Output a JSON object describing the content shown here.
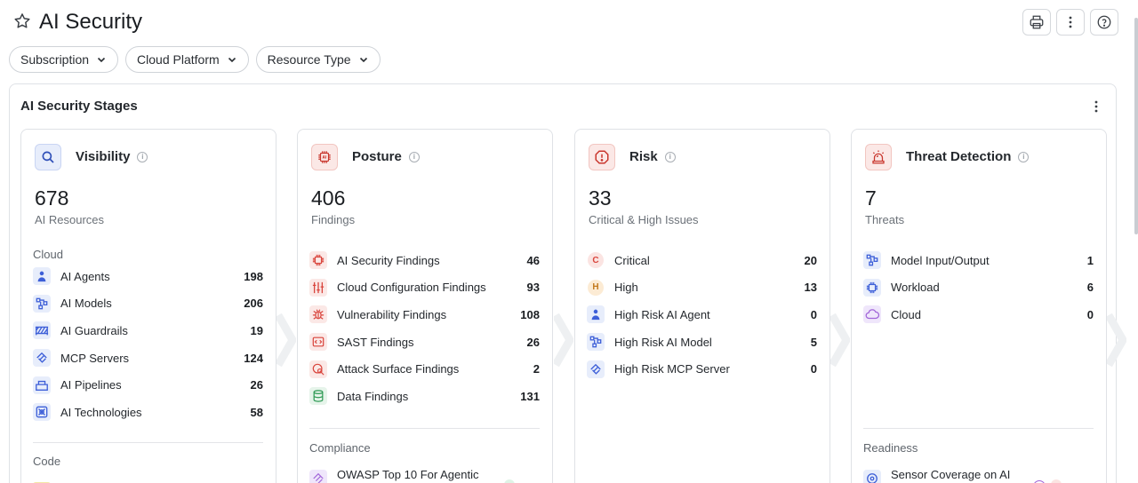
{
  "header": {
    "title": "AI Security"
  },
  "filters": [
    "Subscription",
    "Cloud Platform",
    "Resource Type"
  ],
  "panel": {
    "title": "AI Security Stages"
  },
  "cards": [
    {
      "title": "Visibility",
      "count": "678",
      "subtitle": "AI Resources",
      "sections": [
        {
          "label": "Cloud",
          "rows": [
            {
              "label": "AI Agents",
              "value": "198",
              "icon": "agent-icon"
            },
            {
              "label": "AI Models",
              "value": "206",
              "icon": "model-icon"
            },
            {
              "label": "AI Guardrails",
              "value": "19",
              "icon": "guardrail-icon"
            },
            {
              "label": "MCP Servers",
              "value": "124",
              "icon": "mcp-icon"
            },
            {
              "label": "AI Pipelines",
              "value": "26",
              "icon": "pipeline-icon"
            },
            {
              "label": "AI Technologies",
              "value": "58",
              "icon": "technology-icon"
            }
          ]
        },
        {
          "label": "Code",
          "rows": []
        }
      ]
    },
    {
      "title": "Posture",
      "count": "406",
      "subtitle": "Findings",
      "sections": [
        {
          "label": "",
          "rows": [
            {
              "label": "AI Security Findings",
              "value": "46",
              "icon": "ai-chip-icon"
            },
            {
              "label": "Cloud Configuration Findings",
              "value": "93",
              "icon": "sliders-icon"
            },
            {
              "label": "Vulnerability Findings",
              "value": "108",
              "icon": "bug-icon"
            },
            {
              "label": "SAST Findings",
              "value": "26",
              "icon": "code-icon"
            },
            {
              "label": "Attack Surface Findings",
              "value": "2",
              "icon": "attack-surface-icon"
            },
            {
              "label": "Data Findings",
              "value": "131",
              "icon": "database-icon"
            }
          ]
        },
        {
          "label": "Compliance",
          "rows": [
            {
              "label": "OWASP Top 10 For Agentic",
              "value": "",
              "icon": "owasp-icon"
            }
          ]
        }
      ]
    },
    {
      "title": "Risk",
      "count": "33",
      "subtitle": "Critical & High Issues",
      "sections": [
        {
          "label": "",
          "rows": [
            {
              "label": "Critical",
              "value": "20",
              "letter": "C",
              "icon": "critical-badge-icon"
            },
            {
              "label": "High",
              "value": "13",
              "letter": "H",
              "icon": "high-badge-icon"
            },
            {
              "label": "High Risk AI Agent",
              "value": "0",
              "icon": "agent-icon"
            },
            {
              "label": "High Risk AI Model",
              "value": "5",
              "icon": "model-icon"
            },
            {
              "label": "High Risk MCP Server",
              "value": "0",
              "icon": "mcp-icon"
            }
          ]
        }
      ]
    },
    {
      "title": "Threat Detection",
      "count": "7",
      "subtitle": "Threats",
      "sections": [
        {
          "label": "",
          "rows": [
            {
              "label": "Model Input/Output",
              "value": "1",
              "icon": "model-icon"
            },
            {
              "label": "Workload",
              "value": "6",
              "icon": "workload-icon"
            },
            {
              "label": "Cloud",
              "value": "0",
              "icon": "cloud-icon"
            }
          ]
        },
        {
          "label": "Readiness",
          "rows": [
            {
              "label": "Sensor Coverage on AI",
              "value": "",
              "icon": "sensor-icon"
            }
          ]
        }
      ]
    }
  ],
  "colors": {
    "blue": "#3d5fd8",
    "red": "#d9453d",
    "green": "#2f9a55",
    "purple": "#a064d8"
  }
}
